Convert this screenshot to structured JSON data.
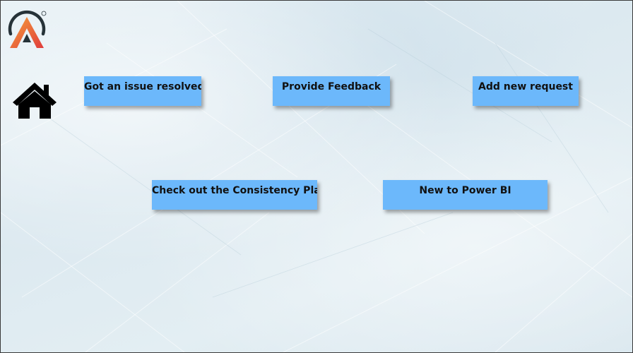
{
  "colors": {
    "background": "#e3eef3",
    "tile": "#6cb8fb",
    "tile_text": "#111111",
    "logo_gradient_start": "#f5a03a",
    "logo_gradient_end": "#e03c3c",
    "logo_dark": "#263238"
  },
  "icons": {
    "logo": "brand-logo-icon",
    "home": "home-icon",
    "registered": "®"
  },
  "tiles": [
    {
      "label": "Got an issue resolved"
    },
    {
      "label": "Provide Feedback"
    },
    {
      "label": "Add new request"
    },
    {
      "label": "Check out the Consistency Plan"
    },
    {
      "label": "New to Power BI"
    }
  ]
}
